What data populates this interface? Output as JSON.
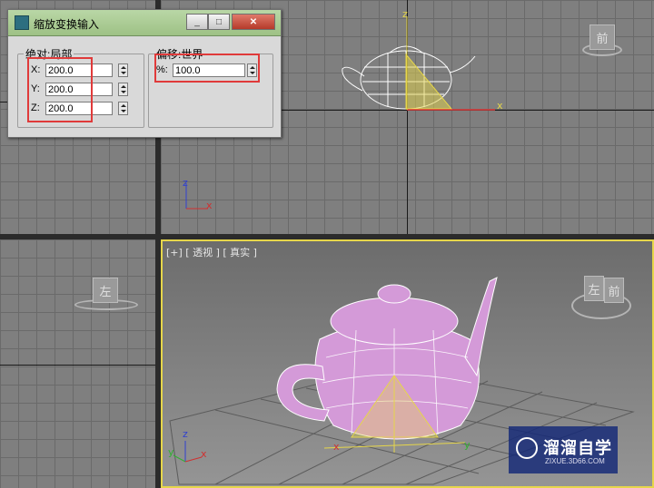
{
  "dialog": {
    "title": "缩放变换输入",
    "absolute_group": "绝对:局部",
    "offset_group": "偏移:世界",
    "fields": [
      {
        "label": "X:",
        "value": "200.0"
      },
      {
        "label": "Y:",
        "value": "200.0"
      },
      {
        "label": "Z:",
        "value": "200.0"
      }
    ],
    "percent": {
      "label": "%:",
      "value": "100.0"
    },
    "buttons": {
      "minimize": "_",
      "maximize": "□",
      "close": "✕"
    }
  },
  "viewports": {
    "front_cube": "前",
    "left_cube": "左",
    "persp_label": "[+] [ 透视 ] [ 真实 ]",
    "persp_cube_left": "左",
    "persp_cube_front": "前",
    "axis": {
      "x": "x",
      "y": "y",
      "z": "z"
    }
  },
  "watermark": {
    "title": "溜溜自学",
    "subtitle": "ZIXUE.3D66.COM"
  },
  "colors": {
    "teapot": "#d49ad8",
    "highlight": "#e03a3a",
    "active_border": "#e6d64a"
  }
}
